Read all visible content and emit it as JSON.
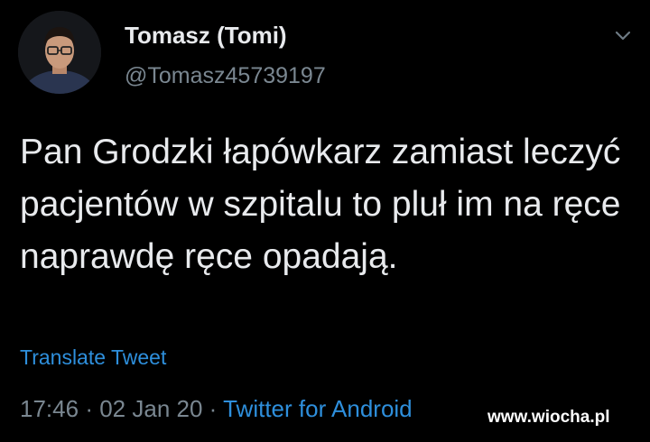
{
  "tweet": {
    "author": {
      "display_name": "Tomasz (Tomi)",
      "handle": "@Tomasz45739197",
      "avatar": "profile-photo-icon"
    },
    "menu_icon": "chevron-down-icon",
    "text": "Pan Grodzki łapówkarz zamiast leczyć pacjentów w szpitalu to pluł im na ręce naprawdę ręce opadają.",
    "translate_label": "Translate Tweet",
    "time": "17:46",
    "separator": "·",
    "date": "02 Jan 20",
    "source": "Twitter for Android"
  },
  "watermark": "www.wiocha.pl",
  "colors": {
    "background": "#000000",
    "text": "#e8eaed",
    "muted": "#7a8791",
    "link": "#2e8fdc"
  }
}
